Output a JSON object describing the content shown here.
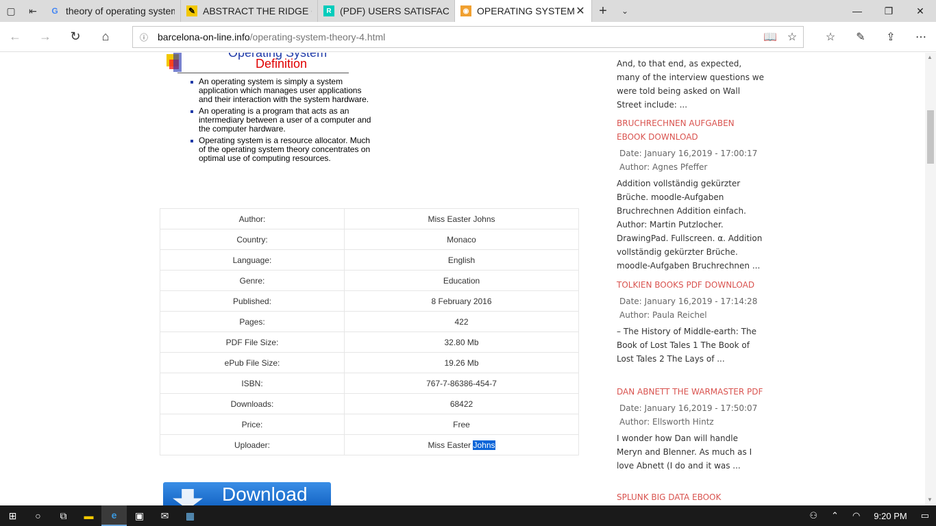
{
  "tabs": [
    {
      "title": "theory of operating system",
      "icon": "google-icon",
      "active": false
    },
    {
      "title": "ABSTRACT THE RIDGE OPEF",
      "icon": "pencil-icon",
      "active": false
    },
    {
      "title": "(PDF) USERS SATISFACTION",
      "icon": "researchgate-icon",
      "active": false
    },
    {
      "title": "OPERATING SYSTEM TH",
      "icon": "rss-icon",
      "active": true
    }
  ],
  "address": {
    "domain": "barcelona-on-line.info",
    "path": "/operating-system-theory-4.html"
  },
  "slide": {
    "title_line1": "Operating System",
    "title_line2": "Definition",
    "bullets": [
      "An operating system is simply a system application which manages user applications and their interaction with the system hardware.",
      "An operating is a program that acts as an intermediary between a user of a computer and the computer hardware.",
      "Operating system is a resource allocator. Much of the operating system theory concentrates on optimal use of computing resources."
    ]
  },
  "book": {
    "rows": [
      {
        "key": "Author:",
        "value": "Miss Easter Johns"
      },
      {
        "key": "Country:",
        "value": "Monaco"
      },
      {
        "key": "Language:",
        "value": "English"
      },
      {
        "key": "Genre:",
        "value": "Education"
      },
      {
        "key": "Published:",
        "value": "8 February 2016"
      },
      {
        "key": "Pages:",
        "value": "422"
      },
      {
        "key": "PDF File Size:",
        "value": "32.80 Mb"
      },
      {
        "key": "ePub File Size:",
        "value": "19.26 Mb"
      },
      {
        "key": "ISBN:",
        "value": "767-7-86386-454-7"
      },
      {
        "key": "Downloads:",
        "value": "68422"
      },
      {
        "key": "Price:",
        "value": "Free"
      }
    ],
    "uploader_key": "Uploader:",
    "uploader_value_plain": "Miss Easter ",
    "uploader_value_selected": "Johns"
  },
  "download_label": "Download",
  "sidebar": {
    "intro": "And, to that end, as expected, many of the interview questions we were told being asked on Wall Street include: ...",
    "posts": [
      {
        "title": "BRUCHRECHNEN AUFGABEN EBOOK DOWNLOAD",
        "date": "Date: January 16,2019 - 17:00:17",
        "author": "Author: Agnes Pfeffer",
        "excerpt": "Addition vollständig gekürzter Brüche. moodle-Aufgaben Bruchrechnen Addition einfach. Author: Martin Putzlocher. DrawingPad. Fullscreen. α. Addition vollständig gekürzter Brüche. moodle-Aufgaben Bruchrechnen ..."
      },
      {
        "title": "TOLKIEN BOOKS PDF DOWNLOAD",
        "date": "Date: January 16,2019 - 17:14:28",
        "author": "Author: Paula Reichel",
        "excerpt": "– The History of Middle-earth: The Book of Lost Tales 1 The Book of Lost Tales 2 The Lays of ..."
      },
      {
        "title": "DAN ABNETT THE WARMASTER PDF",
        "date": "Date: January 16,2019 - 17:50:07",
        "author": "Author: Ellsworth Hintz",
        "excerpt": "I wonder how Dan will handle Meryn and Blenner. As much as I love Abnett (I do and it was ..."
      },
      {
        "title": "SPLUNK BIG DATA EBOOK",
        "date": "",
        "author": "",
        "excerpt": ""
      }
    ]
  },
  "taskbar": {
    "clock": "9:20 PM"
  }
}
